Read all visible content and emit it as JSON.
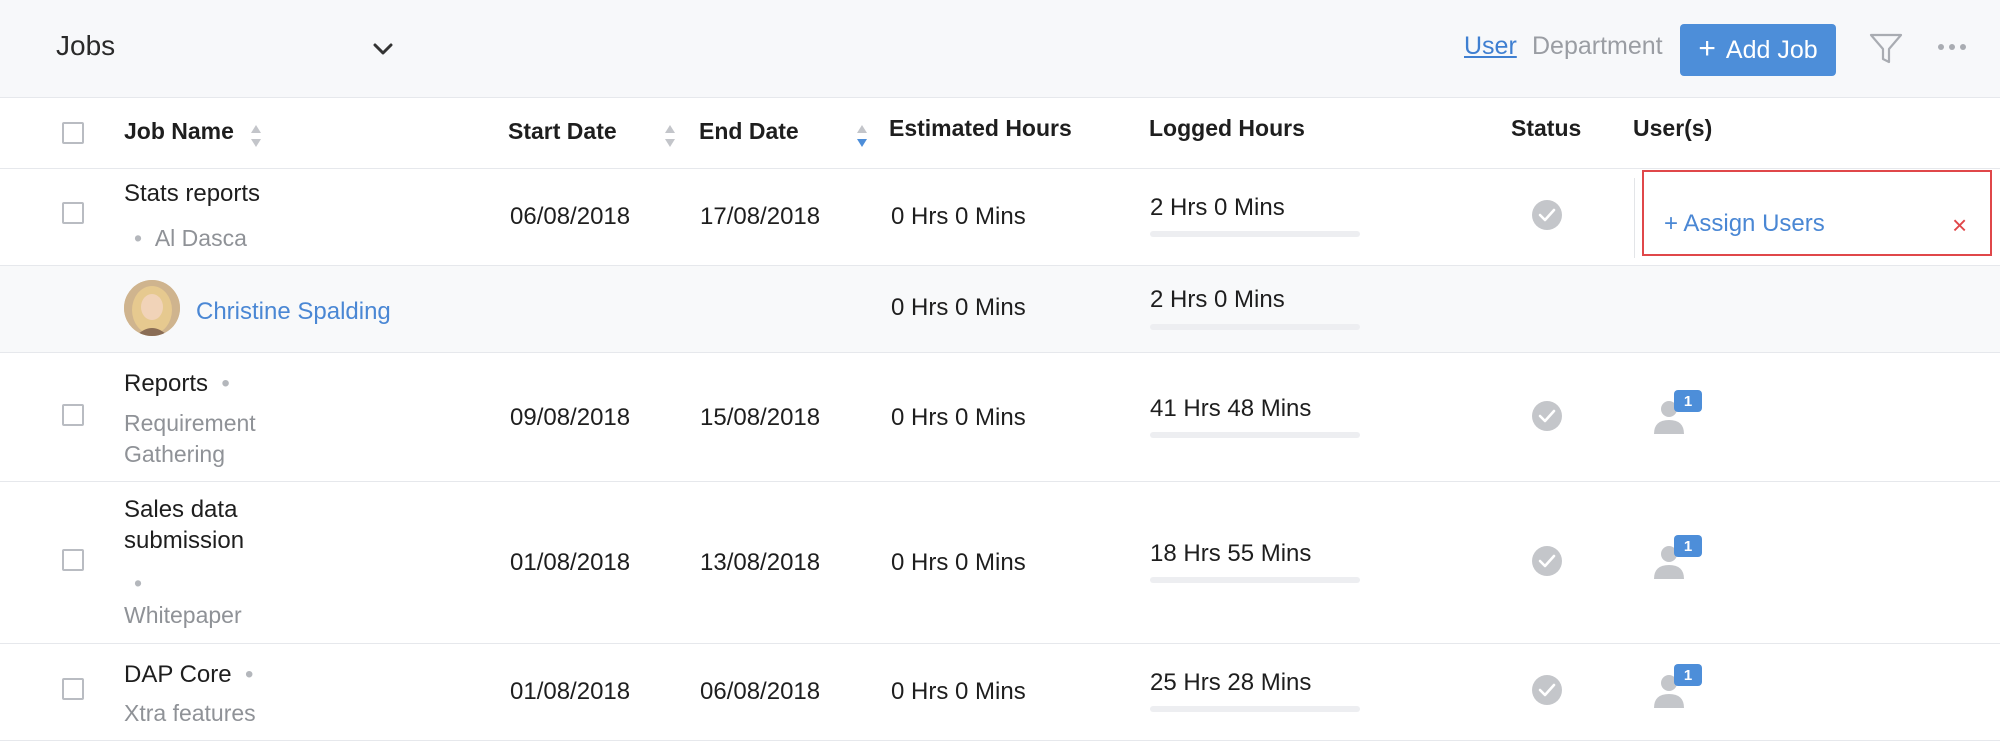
{
  "header": {
    "title": "Jobs",
    "view_user": "User",
    "view_department": "Department",
    "add_job_plus": "+",
    "add_job_label": "Add Job"
  },
  "columns": {
    "job_name": "Job Name",
    "start_date": "Start Date",
    "end_date": "End Date",
    "estimated_hours": "Estimated Hours",
    "logged_hours": "Logged Hours",
    "status": "Status",
    "users": "User(s)"
  },
  "rows": [
    {
      "job": "Stats reports",
      "client_prefix": "•",
      "client": "Al Dasca",
      "start": "06/08/2018",
      "end": "17/08/2018",
      "estimated": "0 Hrs 0 Mins",
      "logged": "2 Hrs 0 Mins",
      "assign_label": "+ Assign Users",
      "remove_icon": "×",
      "sub": {
        "user": "Christine Spalding",
        "estimated": "0 Hrs 0 Mins",
        "logged": "2 Hrs 0 Mins"
      }
    },
    {
      "job": "Reports",
      "dot": "•",
      "client_line1": "Requirement",
      "client_line2": "Gathering",
      "start": "09/08/2018",
      "end": "15/08/2018",
      "estimated": "0 Hrs 0 Mins",
      "logged": "41 Hrs 48 Mins",
      "user_count": "1"
    },
    {
      "job_line1": "Sales data",
      "job_line2": "submission",
      "dot": "•",
      "client": "Whitepaper",
      "start": "01/08/2018",
      "end": "13/08/2018",
      "estimated": "0 Hrs 0 Mins",
      "logged": "18 Hrs 55 Mins",
      "user_count": "1"
    },
    {
      "job": "DAP Core",
      "dot": "•",
      "client": "Xtra features",
      "start": "01/08/2018",
      "end": "06/08/2018",
      "estimated": "0 Hrs 0 Mins",
      "logged": "25 Hrs 28 Mins",
      "user_count": "1"
    }
  ],
  "colors": {
    "accent": "#4d8ed9",
    "link": "#4a87d4",
    "highlight": "#e0474a",
    "muted": "#8f9297"
  },
  "icons": [
    "chevron-down-icon",
    "filter-icon",
    "more-icon",
    "sort-icon",
    "check-circle-icon",
    "user-icon",
    "close-icon"
  ]
}
